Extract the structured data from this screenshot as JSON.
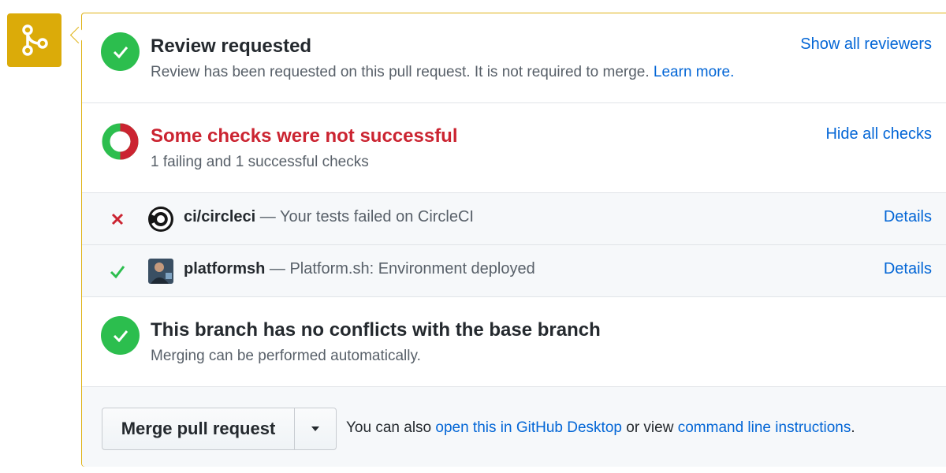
{
  "review": {
    "title": "Review requested",
    "description": "Review has been requested on this pull request. It is not required to merge.",
    "learn_more": "Learn more.",
    "show_reviewers": "Show all reviewers"
  },
  "checks": {
    "title": "Some checks were not successful",
    "summary": "1 failing and 1 successful checks",
    "hide_checks": "Hide all checks",
    "items": [
      {
        "name": "ci/circleci",
        "description": "— Your tests failed on CircleCI",
        "details": "Details",
        "status": "failed"
      },
      {
        "name": "platformsh",
        "description": "— Platform.sh: Environment deployed",
        "details": "Details",
        "status": "success"
      }
    ]
  },
  "conflicts": {
    "title": "This branch has no conflicts with the base branch",
    "description": "Merging can be performed automatically."
  },
  "merge": {
    "button_label": "Merge pull request",
    "note_prefix": "You can also",
    "desktop_link": "open this in GitHub Desktop",
    "note_middle": "or view",
    "cli_link": "command line instructions",
    "note_suffix": "."
  },
  "colors": {
    "success": "#2cbe4e",
    "failure": "#cb2431",
    "pending": "#dbab09",
    "link": "#0366d6"
  }
}
